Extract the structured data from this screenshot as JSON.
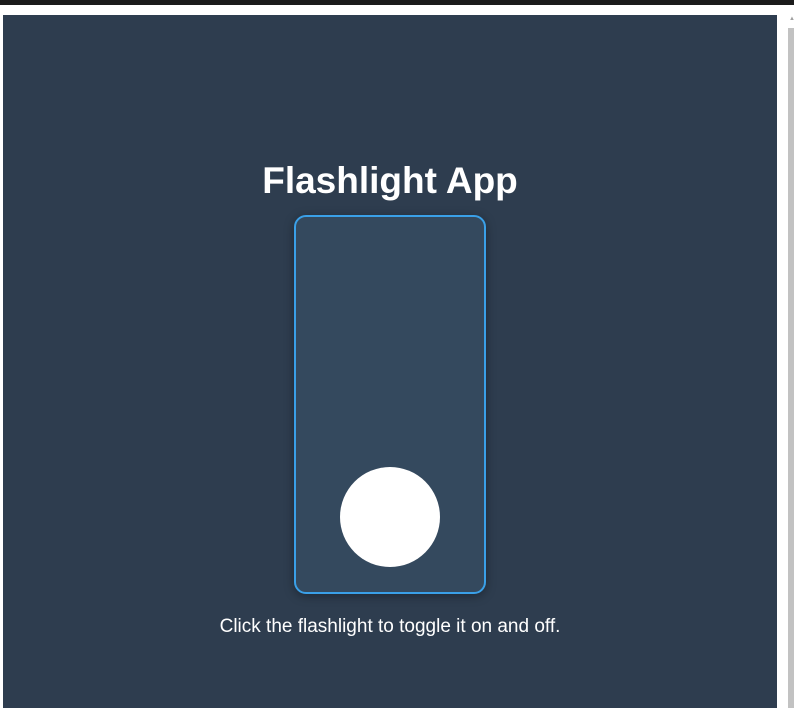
{
  "app": {
    "title": "Flashlight App",
    "instructions": "Click the flashlight to toggle it on and off."
  },
  "colors": {
    "background": "#2e3d4f",
    "flashlight_body": "#34495e",
    "flashlight_border": "#3aa0e8",
    "bulb": "#ffffff",
    "text": "#ffffff"
  },
  "flashlight": {
    "state": "on"
  }
}
